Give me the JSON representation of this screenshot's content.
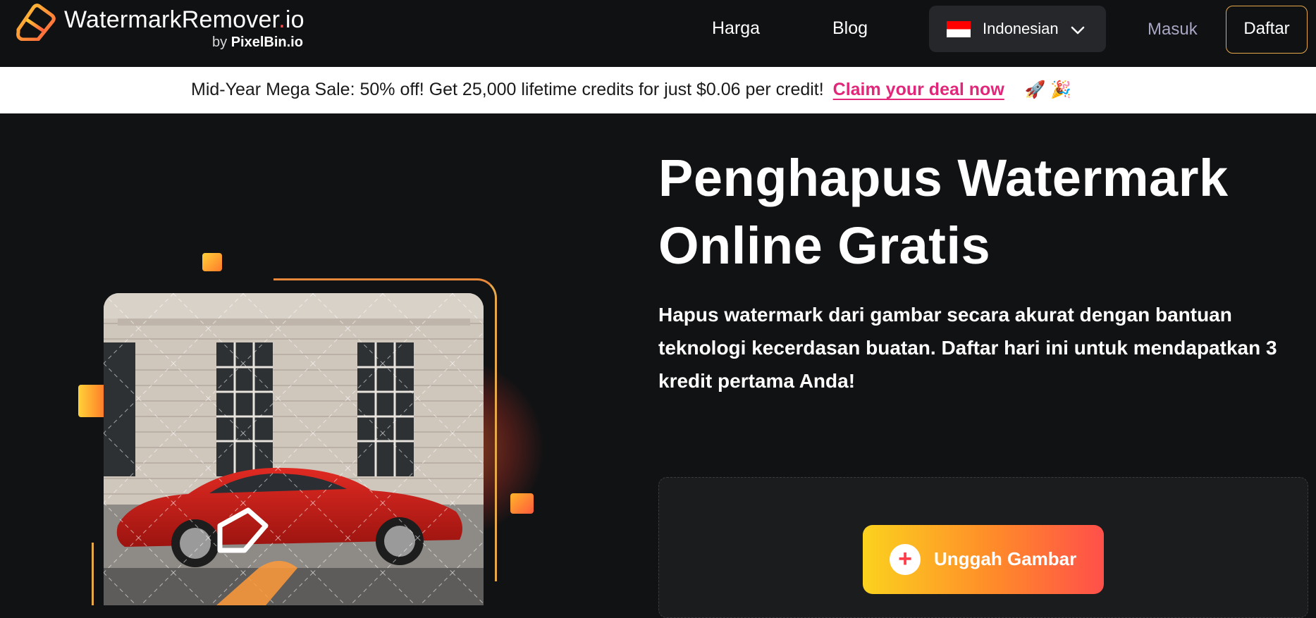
{
  "nav": {
    "brand_name": "WatermarkRemover",
    "brand_dot": ".",
    "brand_tld": "io",
    "byline_prefix": "by",
    "byline_brand": "PixelBin.io",
    "links": [
      "Harga",
      "Blog"
    ],
    "language": {
      "label": "Indonesian",
      "flag": "indonesia-flag-icon"
    },
    "login_label": "Masuk",
    "signup_label": "Daftar"
  },
  "promo": {
    "text": "Mid-Year Mega Sale: 50% off! Get 25,000 lifetime credits for just $0.06 per credit!",
    "link_label": "Claim your deal now",
    "emoji": "🚀 🎉"
  },
  "hero": {
    "title_line1": "Penghapus Watermark",
    "title_line2": "Online Gratis",
    "subtitle": "Hapus watermark dari gambar secara akurat dengan bantuan teknologi kecerdasan buatan. Daftar hari ini untuk mendapatkan 3 kredit pertama Anda!",
    "upload_label": "Unggah Gambar",
    "upload_icon": "plus-icon",
    "image": "red sports car in front of building with watermark pattern"
  },
  "colors": {
    "background": "#111214",
    "promo_link": "#e2277a",
    "accent_orange": "#ff8a2a",
    "accent_yellow": "#fbd21e",
    "accent_red": "#ff4f4a",
    "login_text": "#a7a7c4"
  }
}
